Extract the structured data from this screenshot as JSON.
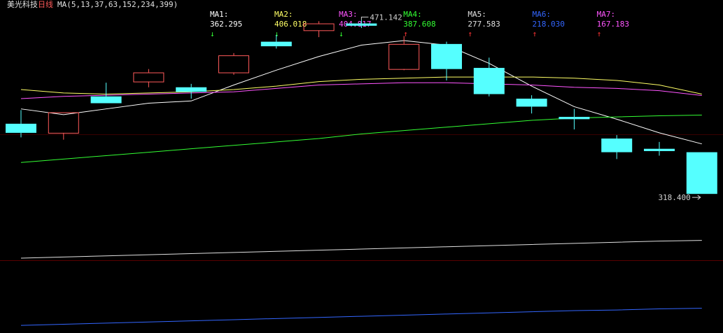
{
  "header": {
    "stock_name": "美光科技",
    "period": "日线",
    "ma_params": "MA(5,13,37,63,152,234,399)"
  },
  "ma_indicators": [
    {
      "label": "MA1:",
      "value": "362.295",
      "arrow": "↓",
      "color": "#ffffff",
      "arrow_color": "#33ff33"
    },
    {
      "label": "MA2:",
      "value": "406.018",
      "arrow": "↓",
      "color": "#ffff66",
      "arrow_color": "#33ff33"
    },
    {
      "label": "MA3:",
      "value": "404.817",
      "arrow": "↓",
      "color": "#ff55ff",
      "arrow_color": "#33ff33"
    },
    {
      "label": "MA4:",
      "value": "387.608",
      "arrow": "↑",
      "color": "#33ff33",
      "arrow_color": "#ff3333"
    },
    {
      "label": "MA5:",
      "value": "277.583",
      "arrow": "↑",
      "color": "#e0e0e0",
      "arrow_color": "#ff3333"
    },
    {
      "label": "MA6:",
      "value": "218.030",
      "arrow": "↑",
      "color": "#3366ff",
      "arrow_color": "#ff3333"
    },
    {
      "label": "MA7:",
      "value": "167.183",
      "arrow": "↑",
      "color": "#ff55ff",
      "arrow_color": "#ff3333"
    }
  ],
  "chart_data": {
    "type": "candlestick",
    "ylim": [
      200,
      480
    ],
    "annotations": [
      {
        "text": "471.142",
        "index": 8,
        "value": 471.142
      },
      {
        "text": "318.400",
        "index": 16,
        "value": 318.4
      }
    ],
    "candles": [
      {
        "open": 380,
        "close": 372,
        "high": 392,
        "low": 368
      },
      {
        "open": 372,
        "close": 390,
        "high": 390,
        "low": 366
      },
      {
        "open": 404,
        "close": 398,
        "high": 416,
        "low": 398
      },
      {
        "open": 417,
        "close": 425,
        "high": 428,
        "low": 412
      },
      {
        "open": 412,
        "close": 408,
        "high": 415,
        "low": 402
      },
      {
        "open": 425,
        "close": 440,
        "high": 442,
        "low": 423
      },
      {
        "open": 452,
        "close": 448,
        "high": 458,
        "low": 446
      },
      {
        "open": 462,
        "close": 468,
        "high": 470,
        "low": 456
      },
      {
        "open": 468,
        "close": 466,
        "high": 471.142,
        "low": 464
      },
      {
        "open": 428,
        "close": 450,
        "high": 457,
        "low": 427
      },
      {
        "open": 450,
        "close": 428,
        "high": 452,
        "low": 418
      },
      {
        "open": 429,
        "close": 406,
        "high": 438,
        "low": 404
      },
      {
        "open": 402,
        "close": 395,
        "high": 405,
        "low": 389
      },
      {
        "open": 386,
        "close": 384,
        "high": 393,
        "low": 375
      },
      {
        "open": 367,
        "close": 355,
        "high": 370,
        "low": 349
      },
      {
        "open": 358,
        "close": 356,
        "high": 364,
        "low": 352
      },
      {
        "open": 355,
        "close": 318.4,
        "high": 355,
        "low": 318.4
      }
    ],
    "ma_lines": [
      {
        "name": "MA1",
        "color": "#ffffff",
        "values": [
          393,
          388,
          393,
          398,
          400,
          414,
          427,
          439,
          449,
          453,
          449,
          433,
          413,
          395,
          384,
          372,
          362.295
        ]
      },
      {
        "name": "MA2",
        "color": "#ffff66",
        "values": [
          410,
          407,
          406,
          407,
          408,
          410,
          413,
          417,
          419,
          420,
          421,
          421,
          421,
          420,
          418,
          414,
          406.018
        ]
      },
      {
        "name": "MA3",
        "color": "#ff55ff",
        "values": [
          402,
          404,
          405,
          406,
          407,
          408,
          411,
          414,
          415,
          416,
          416,
          415,
          414,
          412,
          411,
          409,
          404.817
        ]
      },
      {
        "name": "MA4",
        "color": "#33ff33",
        "values": [
          346,
          349,
          352,
          355,
          358,
          361,
          364,
          367,
          371,
          374,
          377,
          380,
          383,
          385,
          386,
          387,
          387.608
        ]
      },
      {
        "name": "MA5",
        "color": "#e0e0e0",
        "values": [
          262,
          263,
          264,
          265,
          266,
          267,
          268,
          269,
          270,
          271,
          272,
          273,
          274,
          275,
          276,
          277,
          277.583
        ]
      },
      {
        "name": "MA6",
        "color": "#3366ff",
        "values": [
          203,
          204,
          205,
          206,
          207,
          208,
          209,
          210,
          211,
          212,
          213,
          214,
          215,
          216,
          216.5,
          217.5,
          218.03
        ]
      }
    ]
  }
}
